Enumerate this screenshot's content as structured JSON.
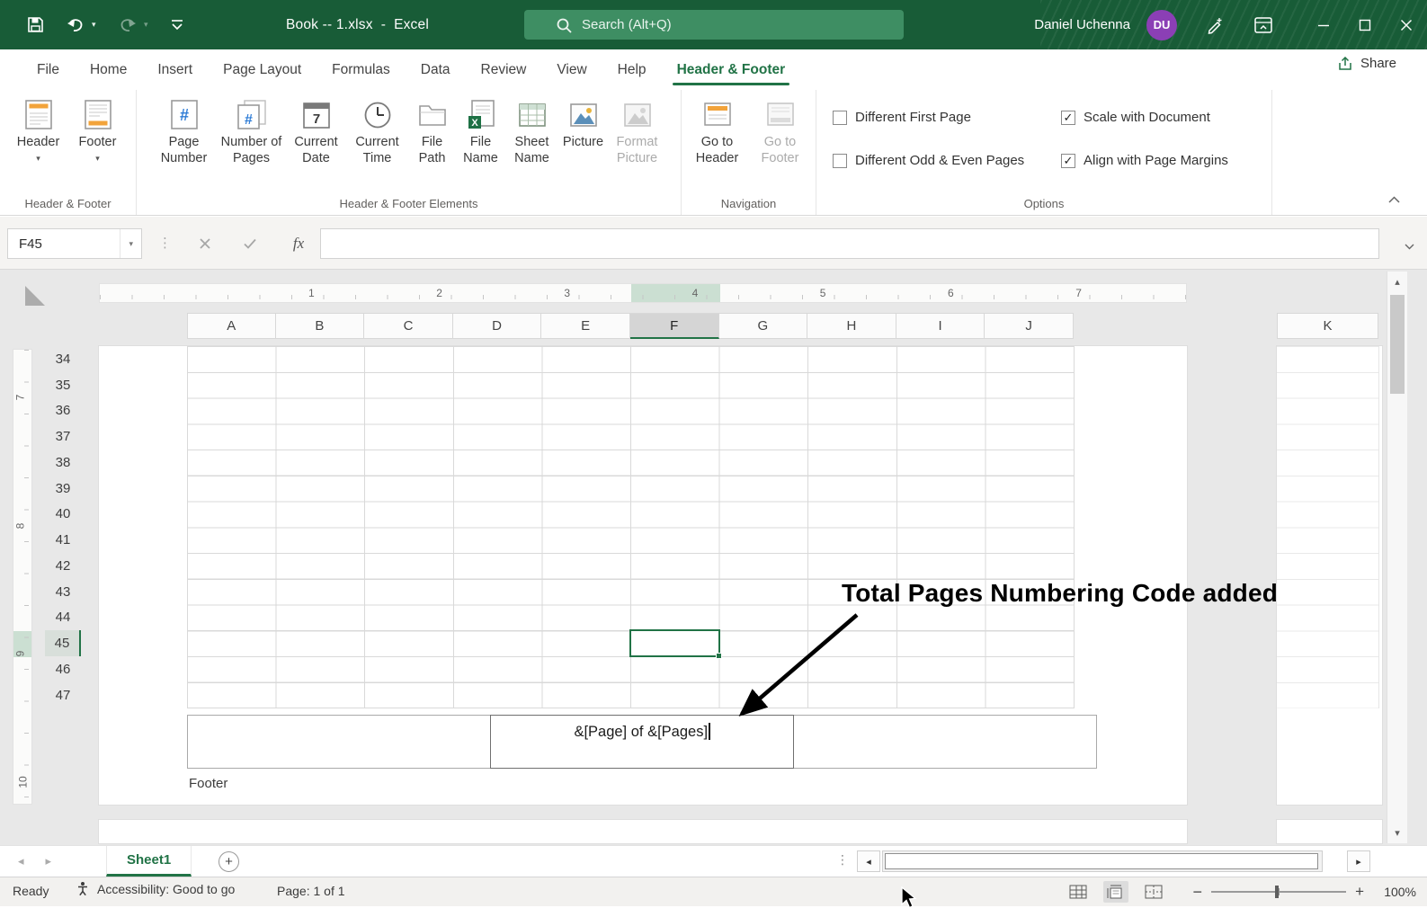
{
  "colors": {
    "titlebar": "#185C37",
    "accent": "#217346",
    "search_bg": "#3E8E63",
    "avatar_bg": "#8B3FB5",
    "grid_line": "#D9D9D9"
  },
  "title_bar": {
    "title": "Book -- 1.xlsx  -  Excel",
    "search_placeholder": "Search (Alt+Q)",
    "user_name": "Daniel Uchenna",
    "user_initials": "DU"
  },
  "ribbon": {
    "tabs": [
      {
        "label": "File",
        "active": false
      },
      {
        "label": "Home",
        "active": false
      },
      {
        "label": "Insert",
        "active": false
      },
      {
        "label": "Page Layout",
        "active": false
      },
      {
        "label": "Formulas",
        "active": false
      },
      {
        "label": "Data",
        "active": false
      },
      {
        "label": "Review",
        "active": false
      },
      {
        "label": "View",
        "active": false
      },
      {
        "label": "Help",
        "active": false
      },
      {
        "label": "Header & Footer",
        "active": true
      }
    ],
    "share_label": "Share",
    "groups": {
      "header_footer": {
        "label": "Header & Footer",
        "buttons": [
          {
            "label": "Header",
            "icon": "header-icon",
            "has_dropdown": true
          },
          {
            "label": "Footer",
            "icon": "footer-icon",
            "has_dropdown": true
          }
        ]
      },
      "elements": {
        "label": "Header & Footer Elements",
        "buttons": [
          {
            "label": "Page Number",
            "icon": "page-number-icon"
          },
          {
            "label": "Number of Pages",
            "icon": "number-of-pages-icon"
          },
          {
            "label": "Current Date",
            "icon": "current-date-icon"
          },
          {
            "label": "Current Time",
            "icon": "current-time-icon"
          },
          {
            "label": "File Path",
            "icon": "file-path-icon"
          },
          {
            "label": "File Name",
            "icon": "file-name-icon"
          },
          {
            "label": "Sheet Name",
            "icon": "sheet-name-icon"
          },
          {
            "label": "Picture",
            "icon": "picture-icon"
          },
          {
            "label": "Format Picture",
            "icon": "format-picture-icon",
            "disabled": true
          }
        ]
      },
      "navigation": {
        "label": "Navigation",
        "buttons": [
          {
            "label": "Go to Header",
            "icon": "goto-header-icon"
          },
          {
            "label": "Go to Footer",
            "icon": "goto-footer-icon",
            "disabled": true
          }
        ]
      },
      "options": {
        "label": "Options",
        "checkboxes": [
          {
            "label": "Different First Page",
            "checked": false
          },
          {
            "label": "Different Odd & Even Pages",
            "checked": false
          },
          {
            "label": "Scale with Document",
            "checked": true
          },
          {
            "label": "Align with Page Margins",
            "checked": true
          }
        ]
      }
    }
  },
  "formula_bar": {
    "name_box": "F45",
    "fx_label": "fx",
    "formula_value": ""
  },
  "worksheet": {
    "h_ruler_numbers": [
      "1",
      "2",
      "3",
      "4",
      "5",
      "6",
      "7"
    ],
    "v_ruler_numbers": [
      "7",
      "8",
      "9",
      "10"
    ],
    "columns": [
      "A",
      "B",
      "C",
      "D",
      "E",
      "F",
      "G",
      "H",
      "I",
      "J",
      "K"
    ],
    "selected_column": "F",
    "rows": [
      "34",
      "35",
      "36",
      "37",
      "38",
      "39",
      "40",
      "41",
      "42",
      "43",
      "44",
      "45",
      "46",
      "47"
    ],
    "selected_row": "45",
    "selected_cell": "F45",
    "footer_code": "&[Page] of &[Pages]",
    "footer_label": "Footer",
    "annotation": "Total Pages Numbering Code added"
  },
  "sheet_tabs": {
    "sheet_name": "Sheet1"
  },
  "status_bar": {
    "ready": "Ready",
    "accessibility": "Accessibility: Good to go",
    "page_info": "Page: 1 of 1",
    "zoom_level": "100%"
  }
}
